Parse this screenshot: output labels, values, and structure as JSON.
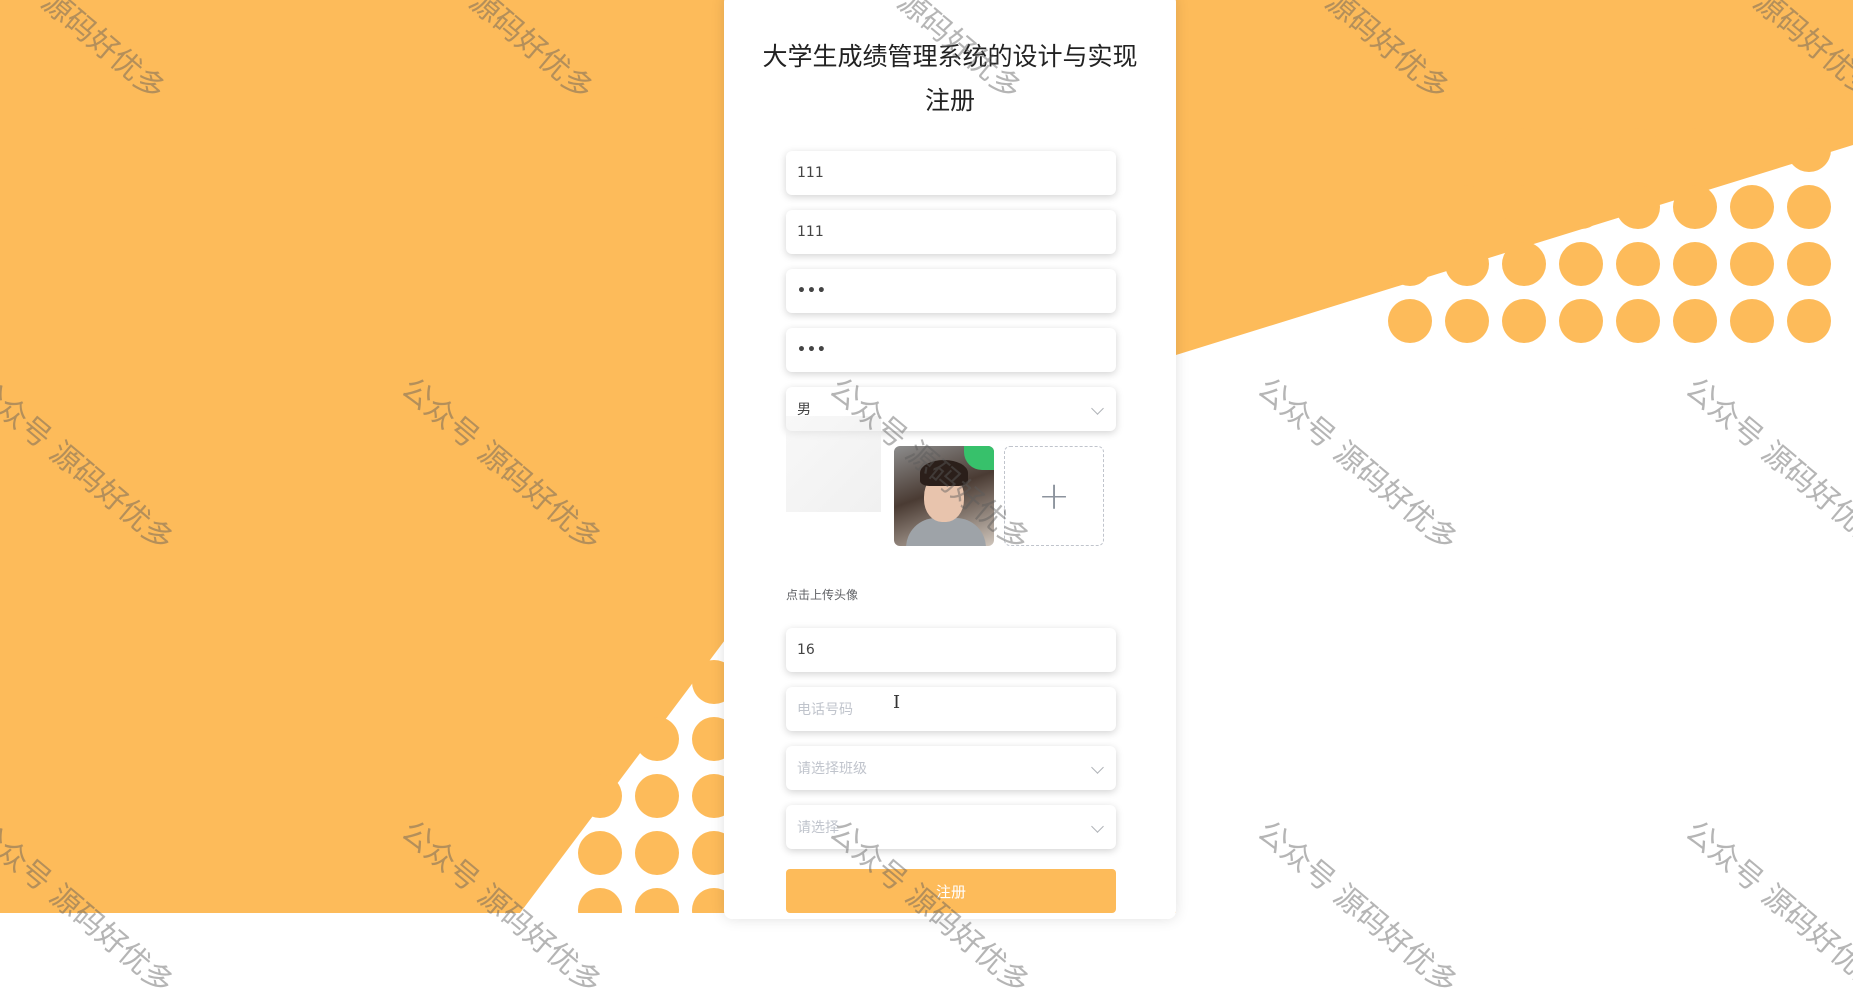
{
  "colors": {
    "accent": "#fdbb5a",
    "background_orange": "#fdbb5a",
    "card": "#ffffff"
  },
  "title": {
    "line1": "大学生成绩管理系统的设计与实现",
    "line2": "注册"
  },
  "form": {
    "account_value": "111",
    "name_value": "111",
    "password_value": "•••",
    "confirm_password_value": "•••",
    "gender_value": "男",
    "avatar_hint": "点击上传头像",
    "uploader_icon": "+",
    "age_value": "16",
    "phone_placeholder": "电话号码",
    "class_placeholder": "请选择班级",
    "second_select_placeholder": "请选择",
    "submit_label": "注册"
  },
  "icons": [
    "chevron-down-icon",
    "plus-icon",
    "text-cursor-icon"
  ],
  "cursor_glyph": "I",
  "watermarks": [
    "源码好优多",
    "公众号 源码好优多"
  ]
}
